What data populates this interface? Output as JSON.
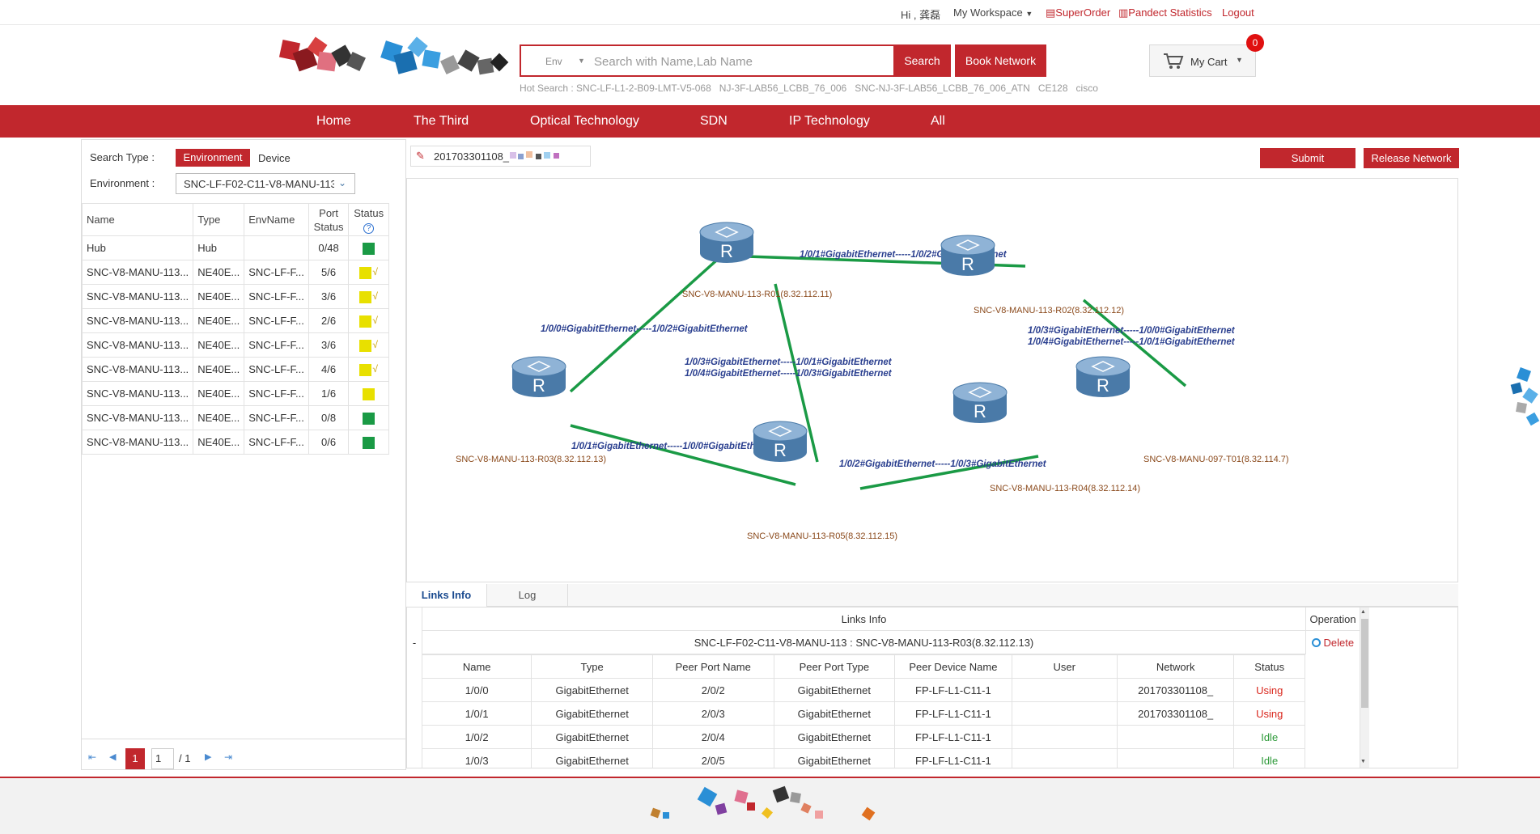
{
  "topbar": {
    "greeting": "Hi , 龚磊",
    "workspace": "My Workspace",
    "super_order": "SuperOrder",
    "pandect": "Pandect Statistics",
    "logout": "Logout"
  },
  "search": {
    "env_label": "Env",
    "placeholder": "Search with Name,Lab Name",
    "search_button": "Search",
    "book_button": "Book Network",
    "hot_label": "Hot Search :",
    "hot_items": [
      "SNC-LF-L1-2-B09-LMT-V5-068",
      "NJ-3F-LAB56_LCBB_76_006",
      "SNC-NJ-3F-LAB56_LCBB_76_006_ATN",
      "CE128",
      "cisco"
    ]
  },
  "cart": {
    "label": "My Cart",
    "count": "0"
  },
  "nav": [
    "Home",
    "The Third",
    "Optical Technology",
    "SDN",
    "IP Technology",
    "All"
  ],
  "left": {
    "search_type_label": "Search Type :",
    "type_env": "Environment",
    "type_device": "Device",
    "env_label": "Environment :",
    "env_value": "SNC-LF-F02-C11-V8-MANU-113",
    "columns": [
      "Name",
      "Type",
      "EnvName",
      "Port Status",
      "Status"
    ],
    "status_help": "?",
    "rows": [
      {
        "name": "Hub",
        "type": "Hub",
        "env": "",
        "port": "0/48",
        "color": "#1a9a45",
        "check": ""
      },
      {
        "name": "SNC-V8-MANU-113...",
        "type": "NE40E...",
        "env": "SNC-LF-F...",
        "port": "5/6",
        "color": "#e8e000",
        "check": "√"
      },
      {
        "name": "SNC-V8-MANU-113...",
        "type": "NE40E...",
        "env": "SNC-LF-F...",
        "port": "3/6",
        "color": "#e8e000",
        "check": "√"
      },
      {
        "name": "SNC-V8-MANU-113...",
        "type": "NE40E...",
        "env": "SNC-LF-F...",
        "port": "2/6",
        "color": "#e8e000",
        "check": "√"
      },
      {
        "name": "SNC-V8-MANU-113...",
        "type": "NE40E...",
        "env": "SNC-LF-F...",
        "port": "3/6",
        "color": "#e8e000",
        "check": "√"
      },
      {
        "name": "SNC-V8-MANU-113...",
        "type": "NE40E...",
        "env": "SNC-LF-F...",
        "port": "4/6",
        "color": "#e8e000",
        "check": "√"
      },
      {
        "name": "SNC-V8-MANU-113...",
        "type": "NE40E...",
        "env": "SNC-LF-F...",
        "port": "1/6",
        "color": "#e8e000",
        "check": ""
      },
      {
        "name": "SNC-V8-MANU-113...",
        "type": "NE40E...",
        "env": "SNC-LF-F...",
        "port": "0/8",
        "color": "#1a9a45",
        "check": ""
      },
      {
        "name": "SNC-V8-MANU-113...",
        "type": "NE40E...",
        "env": "SNC-LF-F...",
        "port": "0/6",
        "color": "#1a9a45",
        "check": ""
      }
    ],
    "pager": {
      "current": "1",
      "input": "1",
      "total": "/ 1"
    }
  },
  "main": {
    "network_name": "201703301108_",
    "submit": "Submit",
    "release": "Release Network",
    "topology": {
      "devices": [
        "SNC-V8-MANU-113-R01(8.32.112.11)",
        "SNC-V8-MANU-113-R02(8.32.112.12)",
        "SNC-V8-MANU-113-R03(8.32.112.13)",
        "SNC-V8-MANU-113-R05(8.32.112.15)",
        "SNC-V8-MANU-113-R04(8.32.112.14)",
        "SNC-V8-MANU-097-T01(8.32.114.7)"
      ],
      "router_glyph": "R",
      "links": [
        "1/0/1#GigabitEthernet-----1/0/2#GigabitEthernet",
        "1/0/0#GigabitEthernet-----1/0/2#GigabitEthernet",
        "1/0/3#GigabitEthernet-----1/0/1#GigabitEthernet",
        "1/0/4#GigabitEthernet-----1/0/3#GigabitEthernet",
        "1/0/3#GigabitEthernet-----1/0/0#GigabitEthernet",
        "1/0/4#GigabitEthernet-----1/0/1#GigabitEthernet",
        "1/0/1#GigabitEthernet-----1/0/0#GigabitEthernet",
        "1/0/2#GigabitEthernet-----1/0/3#GigabitEthernet"
      ]
    },
    "tabs": [
      "Links Info",
      "Log"
    ],
    "links_info": {
      "title": "Links Info",
      "operation": "Operation",
      "group_toggle": "-",
      "group": "SNC-LF-F02-C11-V8-MANU-113 : SNC-V8-MANU-113-R03(8.32.112.13)",
      "delete": "Delete",
      "columns": [
        "Name",
        "Type",
        "Peer Port Name",
        "Peer Port Type",
        "Peer Device Name",
        "User",
        "Network",
        "Status"
      ],
      "rows": [
        {
          "name": "1/0/0",
          "type": "GigabitEthernet",
          "peer_port": "2/0/2",
          "peer_type": "GigabitEthernet",
          "peer_dev": "FP-LF-L1-C11-1",
          "user": "",
          "network": "201703301108_",
          "status": "Using",
          "status_color": "#d9261c"
        },
        {
          "name": "1/0/1",
          "type": "GigabitEthernet",
          "peer_port": "2/0/3",
          "peer_type": "GigabitEthernet",
          "peer_dev": "FP-LF-L1-C11-1",
          "user": "",
          "network": "201703301108_",
          "status": "Using",
          "status_color": "#d9261c"
        },
        {
          "name": "1/0/2",
          "type": "GigabitEthernet",
          "peer_port": "2/0/4",
          "peer_type": "GigabitEthernet",
          "peer_dev": "FP-LF-L1-C11-1",
          "user": "",
          "network": "",
          "status": "Idle",
          "status_color": "#2e9a3a"
        },
        {
          "name": "1/0/3",
          "type": "GigabitEthernet",
          "peer_port": "2/0/5",
          "peer_type": "GigabitEthernet",
          "peer_dev": "FP-LF-L1-C11-1",
          "user": "",
          "network": "",
          "status": "Idle",
          "status_color": "#2e9a3a"
        }
      ]
    }
  },
  "colors": {
    "brand": "#c1272d",
    "link": "#1a9a45",
    "router": "#4a7aa8"
  }
}
